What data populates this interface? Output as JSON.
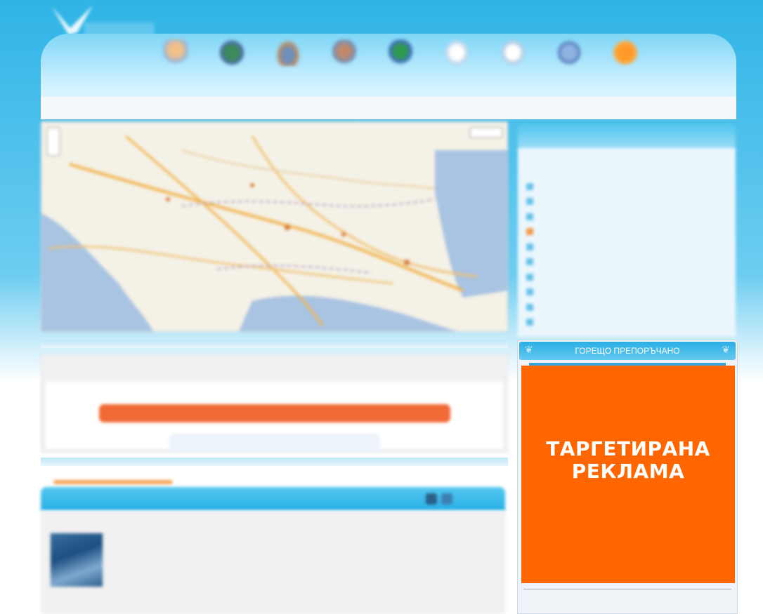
{
  "header": {
    "nav_items": [
      {
        "icon": "person-icon",
        "label": ""
      },
      {
        "icon": "palm-icon",
        "label": ""
      },
      {
        "icon": "plane-icon",
        "label": ""
      },
      {
        "icon": "family-icon",
        "label": ""
      },
      {
        "icon": "globe-icon",
        "label": ""
      },
      {
        "icon": "document-icon",
        "label": ""
      },
      {
        "icon": "contact-icon",
        "label": ""
      },
      {
        "icon": "info-icon",
        "label": ""
      },
      {
        "icon": "orange-star-icon",
        "label": ""
      }
    ]
  },
  "search": {
    "title": "",
    "button_label": "",
    "field_value": ""
  },
  "results": {
    "bar_title": "",
    "bar_link": "",
    "fields": [
      {
        "label": "",
        "value": ""
      },
      {
        "label": "",
        "value": ""
      },
      {
        "label": "",
        "value": ""
      },
      {
        "label": "",
        "value": ""
      },
      {
        "label": "",
        "value": ""
      },
      {
        "label": "",
        "value": ""
      }
    ]
  },
  "destinations": {
    "title": "",
    "items": [
      {
        "label": "",
        "active": false
      },
      {
        "label": "",
        "active": false
      },
      {
        "label": "",
        "active": false
      },
      {
        "label": "",
        "active": true
      },
      {
        "label": "",
        "active": false
      },
      {
        "label": "",
        "active": false
      },
      {
        "label": "",
        "active": false
      },
      {
        "label": "",
        "active": false
      },
      {
        "label": "",
        "active": false
      },
      {
        "label": "",
        "active": false
      }
    ]
  },
  "hot": {
    "title": "ГОРЕЩО ПРЕПОРЪЧАНО",
    "ad_line1": "ТАРГЕТИРАНА",
    "ad_line2": "РЕКЛАМА"
  },
  "colors": {
    "brand_blue": "#2fb4e6",
    "ad_orange": "#ff6600",
    "button_orange": "#f06a35"
  }
}
